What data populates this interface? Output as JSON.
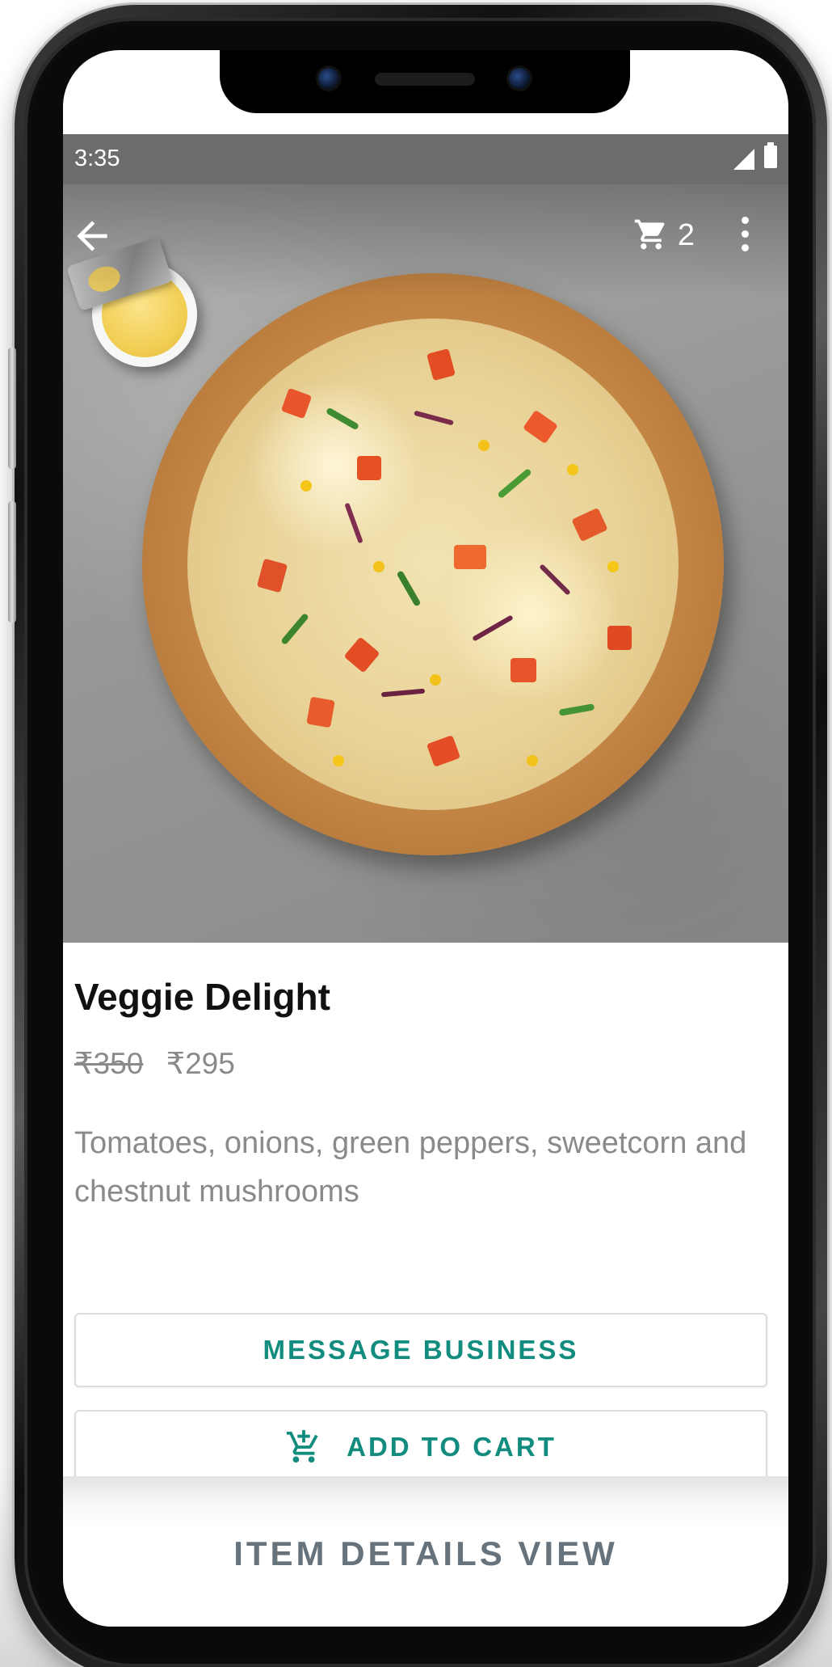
{
  "status_bar": {
    "time": "3:35"
  },
  "app_bar": {
    "back_icon": "arrow-back-icon",
    "cart_icon": "shopping-cart-icon",
    "cart_count": "2",
    "menu_icon": "more-vert-icon"
  },
  "product": {
    "image_subject": "pizza",
    "title": "Veggie Delight",
    "price_original": "₹350",
    "price_current": "₹295",
    "description": "Tomatoes, onions, green peppers, sweetcorn and chestnut mushrooms"
  },
  "actions": {
    "message_label": "MESSAGE BUSINESS",
    "add_to_cart_label": "ADD TO CART",
    "add_to_cart_icon": "add-shopping-cart-icon"
  },
  "footer": {
    "caption": "ITEM DETAILS VIEW"
  },
  "colors": {
    "accent": "#128c7e",
    "status_bar": "#6c6c6c",
    "caption": "#66727c",
    "muted_text": "#8a8a8a"
  }
}
